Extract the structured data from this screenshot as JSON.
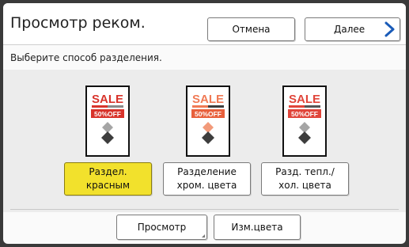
{
  "header": {
    "title": "Просмотр реком.",
    "cancel_label": "Отмена",
    "next_label": "Далее",
    "accent": "#1a5bb8"
  },
  "prompt": "Выберите способ разделения.",
  "thumbnails": [
    {
      "sale": "SALE",
      "discount": "50%OFF",
      "variant": "red-separation",
      "sale_color": "#d8332b",
      "diamond_top_color": "#9a9a9a"
    },
    {
      "sale": "SALE",
      "discount": "50%OFF",
      "variant": "chroma-separation",
      "sale_color": "#f07a55",
      "diamond_top_color": "#f29a7a"
    },
    {
      "sale": "SALE",
      "discount": "50%OFF",
      "variant": "warm-cool-separation",
      "sale_color": "#e0453a",
      "diamond_top_color": "#a5a5a5"
    }
  ],
  "options": [
    {
      "line1": "Раздел.",
      "line2": "красным",
      "selected": true
    },
    {
      "line1": "Разделение",
      "line2": "хром. цвета",
      "selected": false
    },
    {
      "line1": "Разд. тепл./",
      "line2": "хол. цвета",
      "selected": false
    }
  ],
  "footer": {
    "preview_label": "Просмотр",
    "change_color_label": "Изм.цвета"
  },
  "colors": {
    "selected_bg": "#f2e12c",
    "band_bg": "#ececec"
  }
}
